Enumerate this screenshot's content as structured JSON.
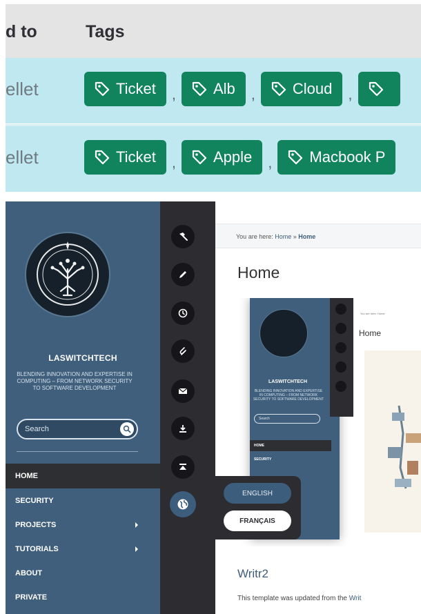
{
  "table": {
    "headers": {
      "assigned_to": "d to",
      "tags": "Tags"
    },
    "separator": ",",
    "rows": [
      {
        "assigned_to": "ellet",
        "tags": [
          "Ticket",
          "Alb",
          "Cloud"
        ]
      },
      {
        "assigned_to": "ellet",
        "tags": [
          "Ticket",
          "Apple",
          "Macbook P"
        ]
      }
    ],
    "tag_icon": "tag-icon",
    "colors": {
      "tag_bg": "#11845d",
      "row_bg": "#bfe8f0",
      "header_bg": "#e4e4e4"
    }
  },
  "site": {
    "title": "LASWITCHTECH",
    "description": "BLENDING INNOVATION AND EXPERTISE IN COMPUTING – FROM NETWORK SECURITY TO SOFTWARE DEVELOPMENT",
    "search": {
      "placeholder": "Search"
    },
    "nav": [
      {
        "label": "HOME",
        "active": true,
        "has_children": false
      },
      {
        "label": "SECURITY",
        "active": false,
        "has_children": false
      },
      {
        "label": "PROJECTS",
        "active": false,
        "has_children": true
      },
      {
        "label": "TUTORIALS",
        "active": false,
        "has_children": true
      },
      {
        "label": "ABOUT",
        "active": false,
        "has_children": false
      },
      {
        "label": "PRIVATE",
        "active": false,
        "has_children": false
      }
    ],
    "toolbar_icons": [
      "hammer-icon",
      "pencil-icon",
      "clock-icon",
      "paperclip-icon",
      "mail-icon",
      "download-icon",
      "eject-icon",
      "globe-icon"
    ],
    "languages": [
      "ENGLISH",
      "FRANÇAIS"
    ],
    "breadcrumb": {
      "prefix": "You are here:",
      "home_link": "Home",
      "separator": "»",
      "current": "Home"
    },
    "page_title": "Home",
    "preview": {
      "title": "LASWITCHTECH",
      "description": "BLENDING INNOVATION AND EXPERTISE IN COMPUTING – FROM NETWORK SECURITY TO SOFTWARE DEVELOPMENT",
      "search_label": "Search",
      "nav": [
        "HOME",
        "SECURITY"
      ],
      "crumb": "You are here: Home",
      "home": "Home"
    },
    "post_title": "Writr2",
    "post_text": "This template was updated from the",
    "post_link": "Writ",
    "colors": {
      "sidebar": "#3f5f7d",
      "iconbar": "#2d2d31",
      "accent": "#3d5d7c"
    }
  }
}
